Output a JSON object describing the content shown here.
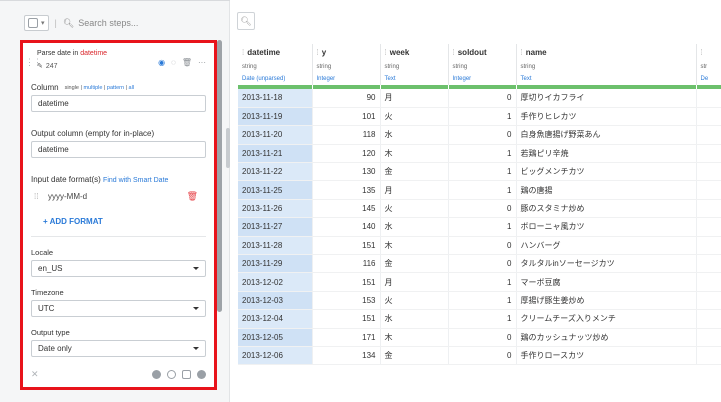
{
  "toolbar": {
    "search_placeholder": "Search steps..."
  },
  "step": {
    "title_prefix": "Parse date in",
    "title_column": "datetime",
    "count": "247",
    "column_label": "Column",
    "mode_single": "single",
    "mode_multiple": "multiple",
    "mode_pattern": "pattern",
    "mode_all": "all",
    "column_value": "datetime",
    "output_label": "Output column (empty for in-place)",
    "output_value": "datetime",
    "formats_label": "Input date format(s)",
    "smart_date_link": "Find with Smart Date",
    "format_value": "yyyy-MM-d",
    "add_format": "+ ADD FORMAT",
    "locale_label": "Locale",
    "locale_value": "en_US",
    "timezone_label": "Timezone",
    "timezone_value": "UTC",
    "output_type_label": "Output type",
    "output_type_value": "Date only"
  },
  "grid": {
    "columns": [
      {
        "name": "datetime",
        "type": "string",
        "meaning": "Date (unparsed)"
      },
      {
        "name": "y",
        "type": "string",
        "meaning": "Integer"
      },
      {
        "name": "week",
        "type": "string",
        "meaning": "Text"
      },
      {
        "name": "soldout",
        "type": "string",
        "meaning": "Integer"
      },
      {
        "name": "name",
        "type": "string",
        "meaning": "Text"
      },
      {
        "name": "",
        "type": "str",
        "meaning": "De"
      }
    ],
    "rows": [
      [
        "2013-11-18",
        "90",
        "月",
        "0",
        "厚切りイカフライ"
      ],
      [
        "2013-11-19",
        "101",
        "火",
        "1",
        "手作りヒレカツ"
      ],
      [
        "2013-11-20",
        "118",
        "水",
        "0",
        "白身魚唐揚げ野菜あん"
      ],
      [
        "2013-11-21",
        "120",
        "木",
        "1",
        "若鶏ピリ辛焼"
      ],
      [
        "2013-11-22",
        "130",
        "金",
        "1",
        "ビッグメンチカツ"
      ],
      [
        "2013-11-25",
        "135",
        "月",
        "1",
        "鶏の唐揚"
      ],
      [
        "2013-11-26",
        "145",
        "火",
        "0",
        "豚のスタミナ炒め"
      ],
      [
        "2013-11-27",
        "140",
        "水",
        "1",
        "ボローニャ風カツ"
      ],
      [
        "2013-11-28",
        "151",
        "木",
        "0",
        "ハンバーグ"
      ],
      [
        "2013-11-29",
        "116",
        "金",
        "0",
        "タルタルinソーセージカツ"
      ],
      [
        "2013-12-02",
        "151",
        "月",
        "1",
        "マーボ豆腐"
      ],
      [
        "2013-12-03",
        "153",
        "火",
        "1",
        "厚揚げ豚生姜炒め"
      ],
      [
        "2013-12-04",
        "151",
        "水",
        "1",
        "クリームチーズ入りメンチ"
      ],
      [
        "2013-12-05",
        "171",
        "木",
        "0",
        "鶏のカッシュナッツ炒め"
      ],
      [
        "2013-12-06",
        "134",
        "金",
        "0",
        "手作りロースカツ"
      ]
    ]
  },
  "colors": {
    "accent": "#2a7ad8",
    "highlight_border": "#e8131b",
    "quality_bar": "#6cc06c"
  },
  "icons": [
    "search-icon",
    "pencil-icon",
    "eye-icon",
    "trash-icon",
    "more-icon",
    "drag-handle-icon",
    "magic-icon"
  ]
}
